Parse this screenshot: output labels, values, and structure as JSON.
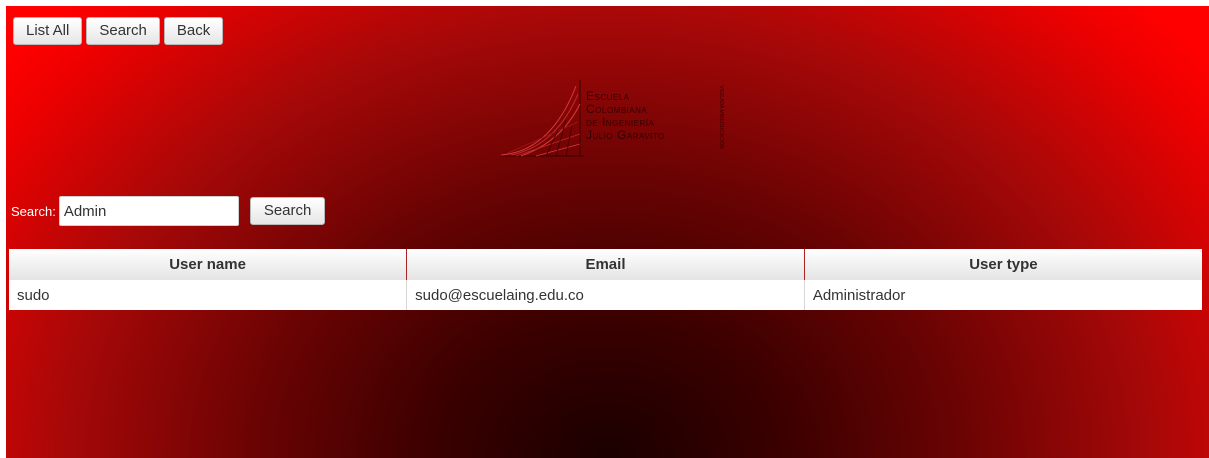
{
  "toolbar": {
    "list_all_label": "List All",
    "search_label": "Search",
    "back_label": "Back"
  },
  "logo": {
    "line1": "Escuela",
    "line2": "Colombiana",
    "line3": "de Ingeniería",
    "line4": "Julio Garavito",
    "vertical_text": "VIGILADA MINEDUCACIÓN"
  },
  "search": {
    "label": "Search:",
    "value": "Admin",
    "button_label": "Search"
  },
  "table": {
    "headers": [
      "User name",
      "Email",
      "User type"
    ],
    "rows": [
      [
        "sudo",
        "sudo@escuelaing.edu.co",
        "Administrador"
      ]
    ]
  },
  "colors": {
    "background_edge": "#ff0000",
    "background_center": "#1a0000"
  }
}
